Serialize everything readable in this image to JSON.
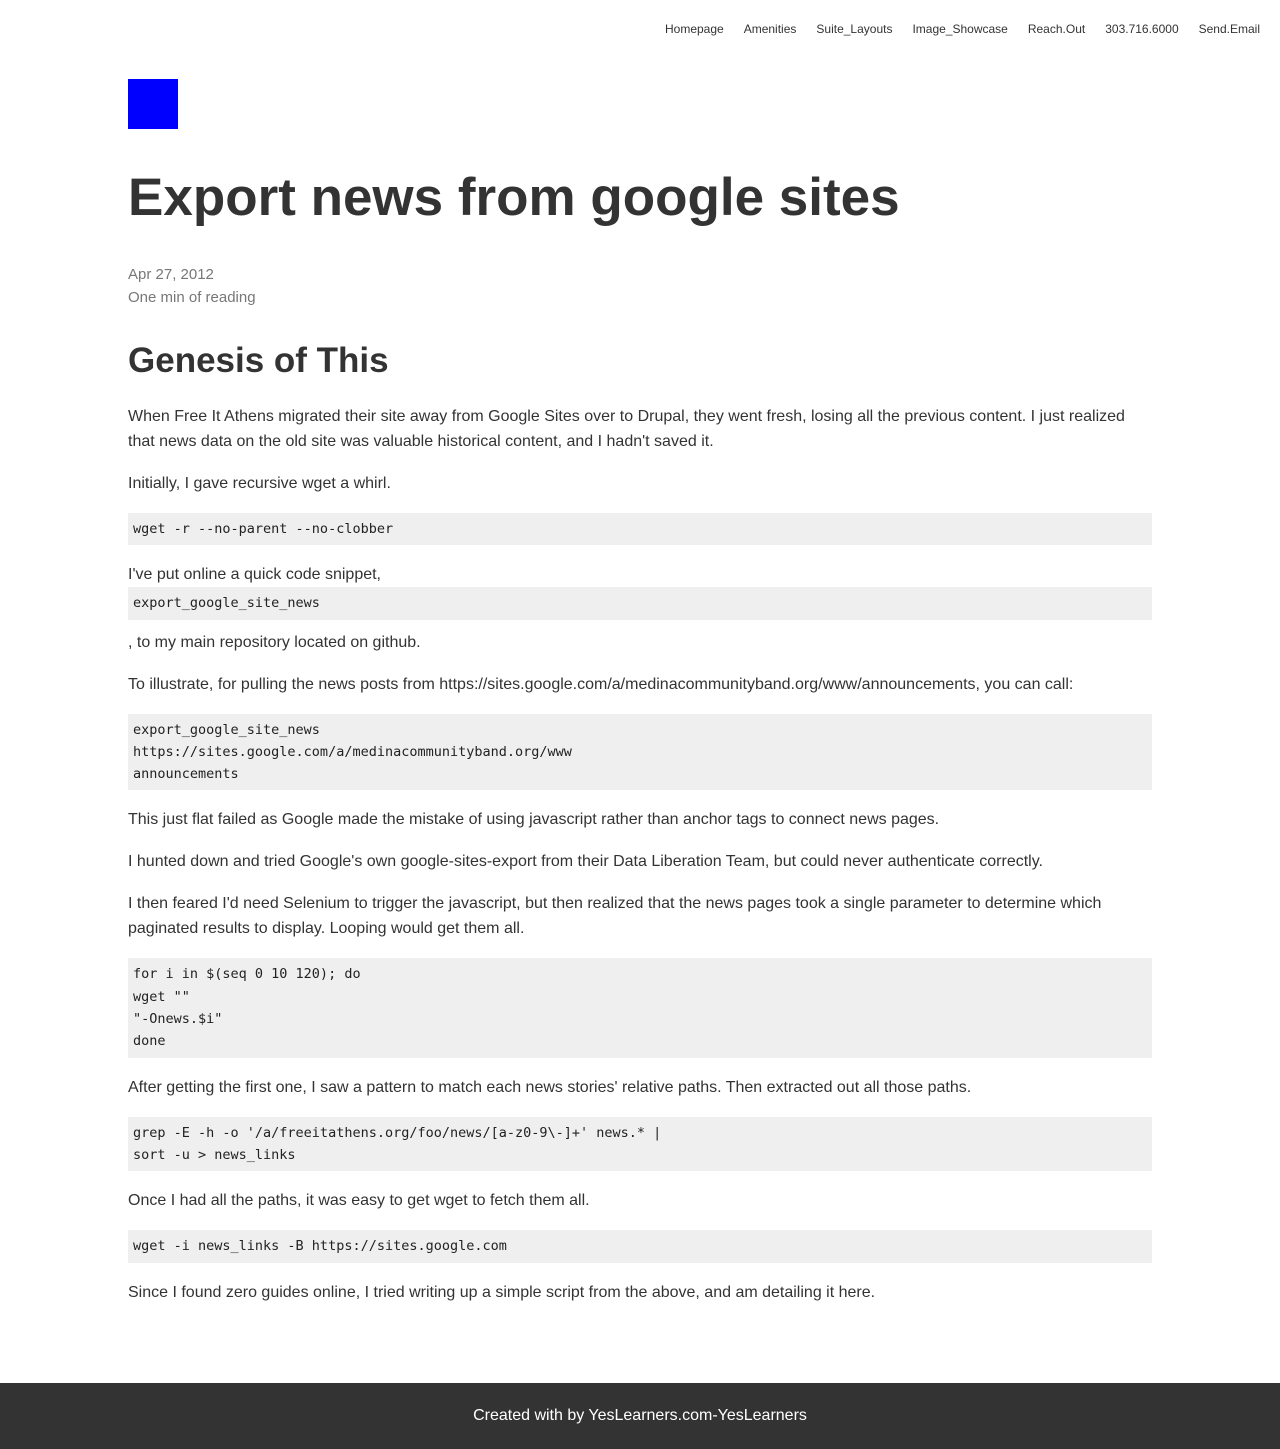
{
  "nav": {
    "items": [
      "Homepage",
      "Amenities",
      "Suite_Layouts",
      "Image_Showcase",
      "Reach.Out",
      "303.716.6000",
      "Send.Email"
    ]
  },
  "logo": {
    "color": "#0000ff"
  },
  "post": {
    "title": "Export news from google sites",
    "date": "Apr 27, 2012",
    "reading_time": "One min of reading"
  },
  "article": {
    "heading": "Genesis of This",
    "p1": "When Free It Athens migrated their site away from Google Sites over to Drupal, they went fresh, losing all the previous content. I just realized that news data on the old site was valuable historical content, and I hadn't saved it.",
    "p2": "Initially, I gave recursive wget a whirl.",
    "code1": [
      "wget -r --no-parent --no-clobber"
    ],
    "p3": "I've put online a quick code snippet,",
    "code2": [
      "export_google_site_news"
    ],
    "p4": ", to my main repository located on github.",
    "p5": "To illustrate, for pulling the news posts from https://sites.google.com/a/medinacommunityband.org/www/announcements, you can call:",
    "code3": [
      "export_google_site_news",
      "https://sites.google.com/a/medinacommunityband.org/www",
      "announcements"
    ],
    "p6": "This just flat failed as Google made the mistake of using javascript rather than anchor tags to connect news pages.",
    "p7": "I hunted down and tried Google's own google-sites-export from their Data Liberation Team, but could never authenticate correctly.",
    "p8": "I then feared I'd need Selenium to trigger the javascript, but then realized that the news pages took a single parameter to determine which paginated results to display. Looping would get them all.",
    "code4": [
      "for i in $(seq 0 10 120); do",
      "wget \"\"",
      "\"-Onews.$i\"",
      "done"
    ],
    "p9": "After getting the first one, I saw a pattern to match each news stories' relative paths. Then extracted out all those paths.",
    "code5": [
      "grep -E -h -o '/a/freeitathens.org/foo/news/[a-z0-9\\-]+' news.* |",
      "sort -u > news_links"
    ],
    "p10": "Once I had all the paths, it was easy to get wget to fetch them all.",
    "code6": [
      "wget -i news_links -B https://sites.google.com"
    ],
    "p11": "Since I found zero guides online, I tried writing up a simple script from the above, and am detailing it here."
  },
  "footer": {
    "text": "Created with by YesLearners.com-YesLearners"
  }
}
